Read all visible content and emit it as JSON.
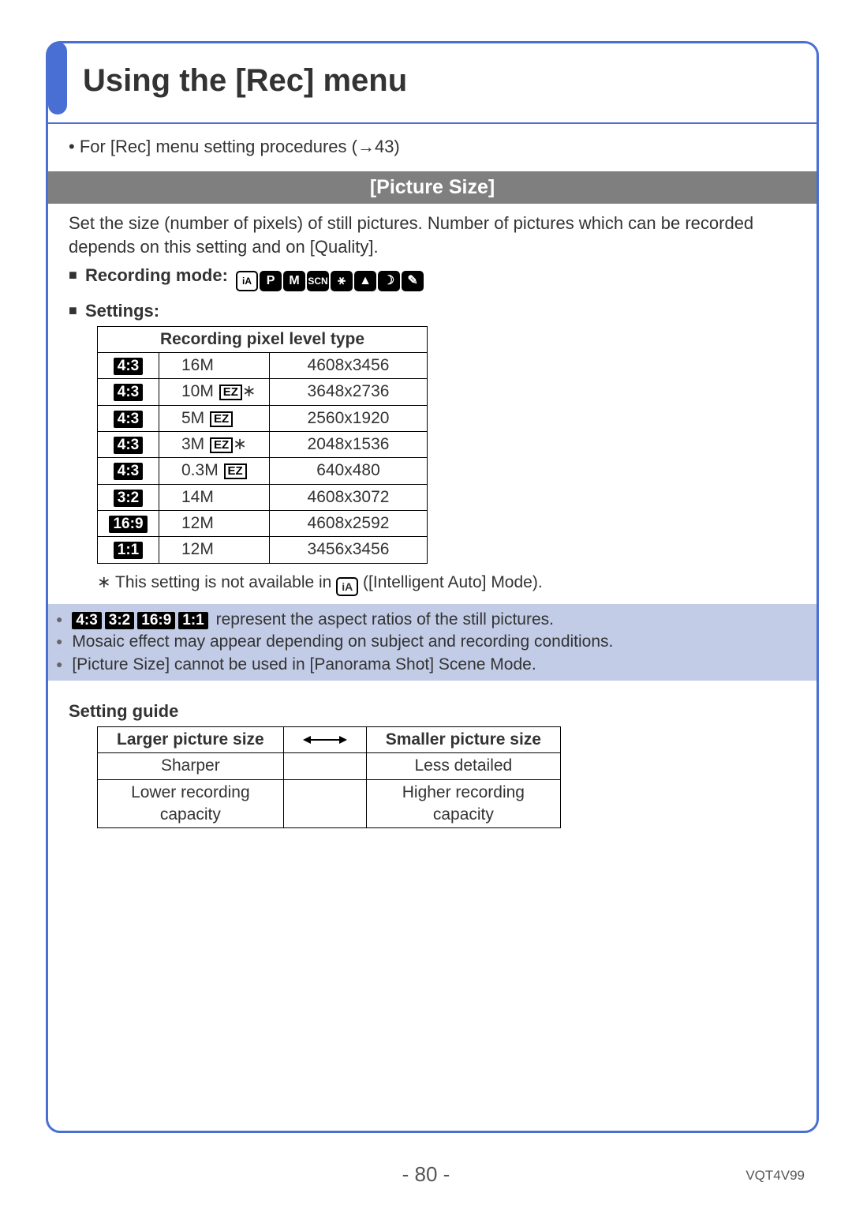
{
  "title": "Using the [Rec] menu",
  "intro": "• For [Rec] menu setting procedures (→43)",
  "section_heading": "[Picture Size]",
  "section_desc": "Set the size (number of pixels) of still pictures. Number of pictures which can be recorded depends on this setting and on [Quality].",
  "recording_mode_label": "Recording mode:",
  "mode_icons": [
    "iA",
    "P",
    "M",
    "SCN",
    "⚹",
    "▲",
    "☽",
    "✎"
  ],
  "settings_label": "Settings:",
  "pixel_table": {
    "header": "Recording pixel level type",
    "rows": [
      {
        "aspect": "4:3",
        "size": "16M",
        "ez": false,
        "star": false,
        "res": "4608x3456"
      },
      {
        "aspect": "4:3",
        "size": "10M",
        "ez": true,
        "star": true,
        "res": "3648x2736"
      },
      {
        "aspect": "4:3",
        "size": "5M",
        "ez": true,
        "star": false,
        "res": "2560x1920"
      },
      {
        "aspect": "4:3",
        "size": "3M",
        "ez": true,
        "star": true,
        "res": "2048x1536"
      },
      {
        "aspect": "4:3",
        "size": "0.3M",
        "ez": true,
        "star": false,
        "res": "640x480"
      },
      {
        "aspect": "3:2",
        "size": "14M",
        "ez": false,
        "star": false,
        "res": "4608x3072"
      },
      {
        "aspect": "16:9",
        "size": "12M",
        "ez": false,
        "star": false,
        "res": "4608x2592"
      },
      {
        "aspect": "1:1",
        "size": "12M",
        "ez": false,
        "star": false,
        "res": "3456x3456"
      }
    ]
  },
  "footnote_prefix": "∗ This setting is not available in ",
  "footnote_suffix": " ([Intelligent Auto] Mode).",
  "callout": {
    "aspects": [
      "4:3",
      "3:2",
      "16:9",
      "1:1"
    ],
    "line1_suffix": " represent the aspect ratios of the still pictures.",
    "line2": "Mosaic effect may appear depending on subject and recording conditions.",
    "line3": "[Picture Size] cannot be used in [Panorama Shot] Scene Mode."
  },
  "guide_title": "Setting guide",
  "guide_table": {
    "head_left": "Larger picture size",
    "head_right": "Smaller picture size",
    "rows": [
      [
        "Sharper",
        "Less detailed"
      ],
      [
        "Lower recording\ncapacity",
        "Higher recording\ncapacity"
      ]
    ]
  },
  "page_number": "- 80 -",
  "doc_id": "VQT4V99"
}
